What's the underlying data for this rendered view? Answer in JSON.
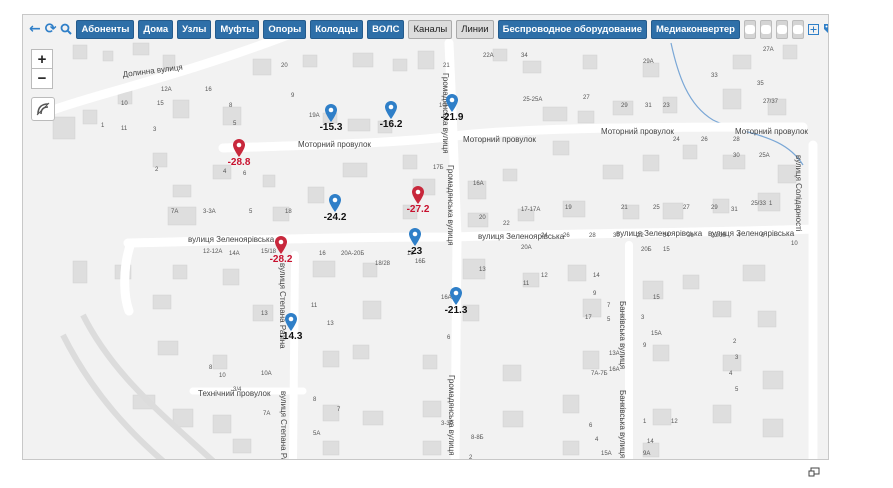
{
  "toolbar": {
    "buttons": [
      "Абоненты",
      "Дома",
      "Узлы",
      "Муфты",
      "Опоры",
      "Колодцы",
      "ВОЛС"
    ],
    "toggles": [
      "Каналы",
      "Линии"
    ],
    "buttons2": [
      "Беспроводное оборудование",
      "Медиаконвертер"
    ],
    "icons": [
      "back-arrow-icon",
      "refresh-icon",
      "search-icon",
      "plus-square-icon",
      "tag-icon",
      "pencil-icon"
    ]
  },
  "zoom": {
    "in": "+",
    "out": "−"
  },
  "streets": {
    "dolynna": "Долинна вулиця",
    "motornyi1": "Моторний провулок",
    "motornyi2": "Моторний провулок",
    "motornyi3": "Моторний провулок",
    "motornyi4": "Моторний провулок",
    "zeleno1": "вулиця Зеленоярівська",
    "zeleno2": "вулиця Зеленоярівська",
    "zeleno3": "вулиця Зеленоярівська",
    "zeleno4": "вулиця Зеленоярівська",
    "hromad1": "Громадянська вулиця",
    "hromad2": "Громадянська вулиця",
    "hromad3": "Громадянська вулиця",
    "stepana1": "вулиця Степана Разіна",
    "stepana2": "вулиця Степана Разіна",
    "bankivska1": "Банківська вулиця",
    "bankivska2": "Банківська вулиця",
    "solidarnosti": "вулиця Солідарності",
    "tekhnichnyi": "Технічний провулок"
  },
  "markers": [
    {
      "value": "-15.3",
      "color": "blue"
    },
    {
      "value": "-16.2",
      "color": "blue"
    },
    {
      "value": "-21.9",
      "color": "blue"
    },
    {
      "value": "-28.8",
      "color": "red"
    },
    {
      "value": "-27.2",
      "color": "red"
    },
    {
      "value": "-24.2",
      "color": "blue"
    },
    {
      "value": "-28.2",
      "color": "red"
    },
    {
      "value": "-23",
      "color": "blue"
    },
    {
      "value": "-21.3",
      "color": "blue"
    },
    {
      "value": "-14.3",
      "color": "blue"
    }
  ],
  "house_numbers": [
    "20",
    "21",
    "22А",
    "34",
    "29А",
    "27А",
    "33",
    "35",
    "27/37",
    "12А",
    "16",
    "10",
    "15",
    "8",
    "5",
    "1",
    "3",
    "9",
    "19А",
    "25-25А",
    "27",
    "29",
    "31",
    "23",
    "10А",
    "11",
    "24",
    "26",
    "28",
    "30",
    "25А",
    "2",
    "4",
    "6",
    "17Б",
    "16А",
    "17-17А",
    "19",
    "21",
    "25",
    "27",
    "29",
    "31",
    "25/33",
    "1",
    "7А",
    "3-3А",
    "5",
    "18",
    "20",
    "22",
    "24",
    "26",
    "28",
    "30",
    "32",
    "34",
    "36",
    "23/36",
    "4",
    "6",
    "10",
    "12-12А",
    "14А",
    "15/18",
    "16",
    "20А-20Б",
    "18/28",
    "18",
    "16Б",
    "20А",
    "20Б",
    "15",
    "13",
    "12",
    "11",
    "14",
    "9",
    "7",
    "5",
    "3",
    "15А",
    "13А",
    "16А",
    "7А-7Б",
    "16А",
    "17",
    "15",
    "13",
    "11",
    "2",
    "3",
    "4",
    "5",
    "8",
    "10",
    "10А",
    "3/4",
    "8",
    "7",
    "7А",
    "5А",
    "3-3А",
    "8-8Б",
    "6",
    "4",
    "15А",
    "9А",
    "14",
    "1",
    "12",
    "2",
    "6",
    "9",
    "13"
  ],
  "colors": {
    "marker_blue": "#2f7fc8",
    "marker_red": "#c8283c",
    "toolbar_button": "#2e6fa8",
    "map_bg": "#f2f2f2",
    "road": "#ffffff",
    "building": "#dedede",
    "water": "#7aa7d6"
  }
}
